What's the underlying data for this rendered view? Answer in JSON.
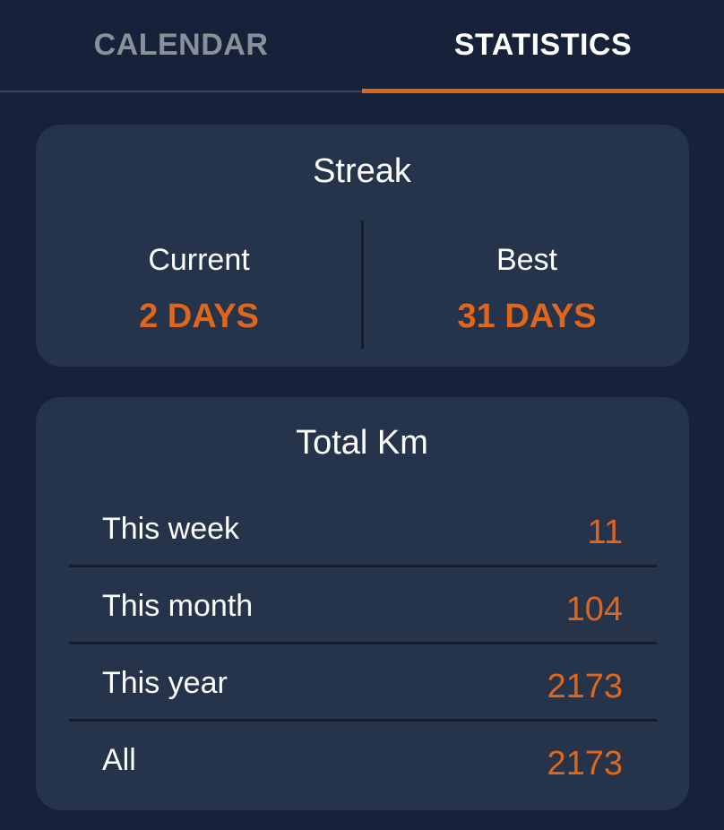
{
  "tabs": [
    {
      "label": "CALENDAR",
      "active": false
    },
    {
      "label": "STATISTICS",
      "active": true
    }
  ],
  "colors": {
    "background": "#16213a",
    "card": "#25344b",
    "accent": "#e0661b",
    "inactive_tab": "#8a8f98"
  },
  "streak": {
    "title": "Streak",
    "current_label": "Current",
    "current_value": "2 DAYS",
    "best_label": "Best",
    "best_value": "31 DAYS"
  },
  "total_km": {
    "title": "Total Km",
    "rows": [
      {
        "label": "This week",
        "value": "11"
      },
      {
        "label": "This month",
        "value": "104"
      },
      {
        "label": "This year",
        "value": "2173"
      },
      {
        "label": "All",
        "value": "2173"
      }
    ]
  }
}
